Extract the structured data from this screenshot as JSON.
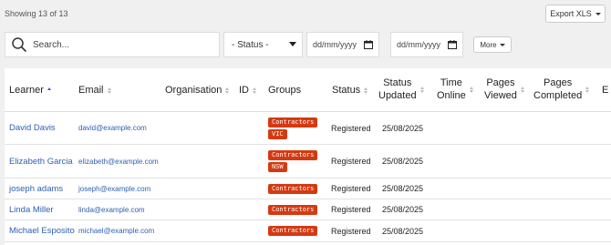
{
  "summary": {
    "showing_text": "Showing 13 of 13",
    "export_label": "Export XLS"
  },
  "filters": {
    "search_placeholder": "Search...",
    "status_label": "- Status -",
    "date_from_placeholder": "dd/mm/yyyy",
    "date_to_placeholder": "dd/mm/yyyy",
    "more_label": "More"
  },
  "table": {
    "columns": {
      "learner": "Learner",
      "email": "Email",
      "organisation": "Organisation",
      "id": "ID",
      "groups": "Groups",
      "status": "Status",
      "status_updated_1": "Status",
      "status_updated_2": "Updated",
      "time_online_1": "Time",
      "time_online_2": "Online",
      "pages_viewed_1": "Pages",
      "pages_viewed_2": "Viewed",
      "pages_completed_1": "Pages",
      "pages_completed_2": "Completed",
      "cut_off": "E"
    },
    "rows": [
      {
        "learner": "David Davis",
        "email": "david@example.com",
        "groups": [
          "Contractors",
          "VIC"
        ],
        "status": "Registered",
        "updated": "25/08/2025"
      },
      {
        "learner": "Elizabeth Garcia",
        "email": "elizabeth@example.com",
        "groups": [
          "Contractors",
          "NSW"
        ],
        "status": "Registered",
        "updated": "25/08/2025"
      },
      {
        "learner": "joseph adams",
        "email": "joseph@example.com",
        "groups": [
          "Contractors"
        ],
        "status": "Registered",
        "updated": "25/08/2025"
      },
      {
        "learner": "Linda Miller",
        "email": "linda@example.com",
        "groups": [
          "Contractors"
        ],
        "status": "Registered",
        "updated": "25/08/2025"
      },
      {
        "learner": "Michael Esposito",
        "email": "michael@example.com",
        "groups": [
          "Contractors"
        ],
        "status": "Registered",
        "updated": "25/08/2025"
      }
    ]
  },
  "colors": {
    "link": "#2f5fb3",
    "badge": "#d43a12",
    "sort_active": "#3a5bbf"
  },
  "icons": {
    "search": "search-icon",
    "calendar": "calendar-icon",
    "caret": "caret-down-icon",
    "sort": "sort-icon"
  }
}
